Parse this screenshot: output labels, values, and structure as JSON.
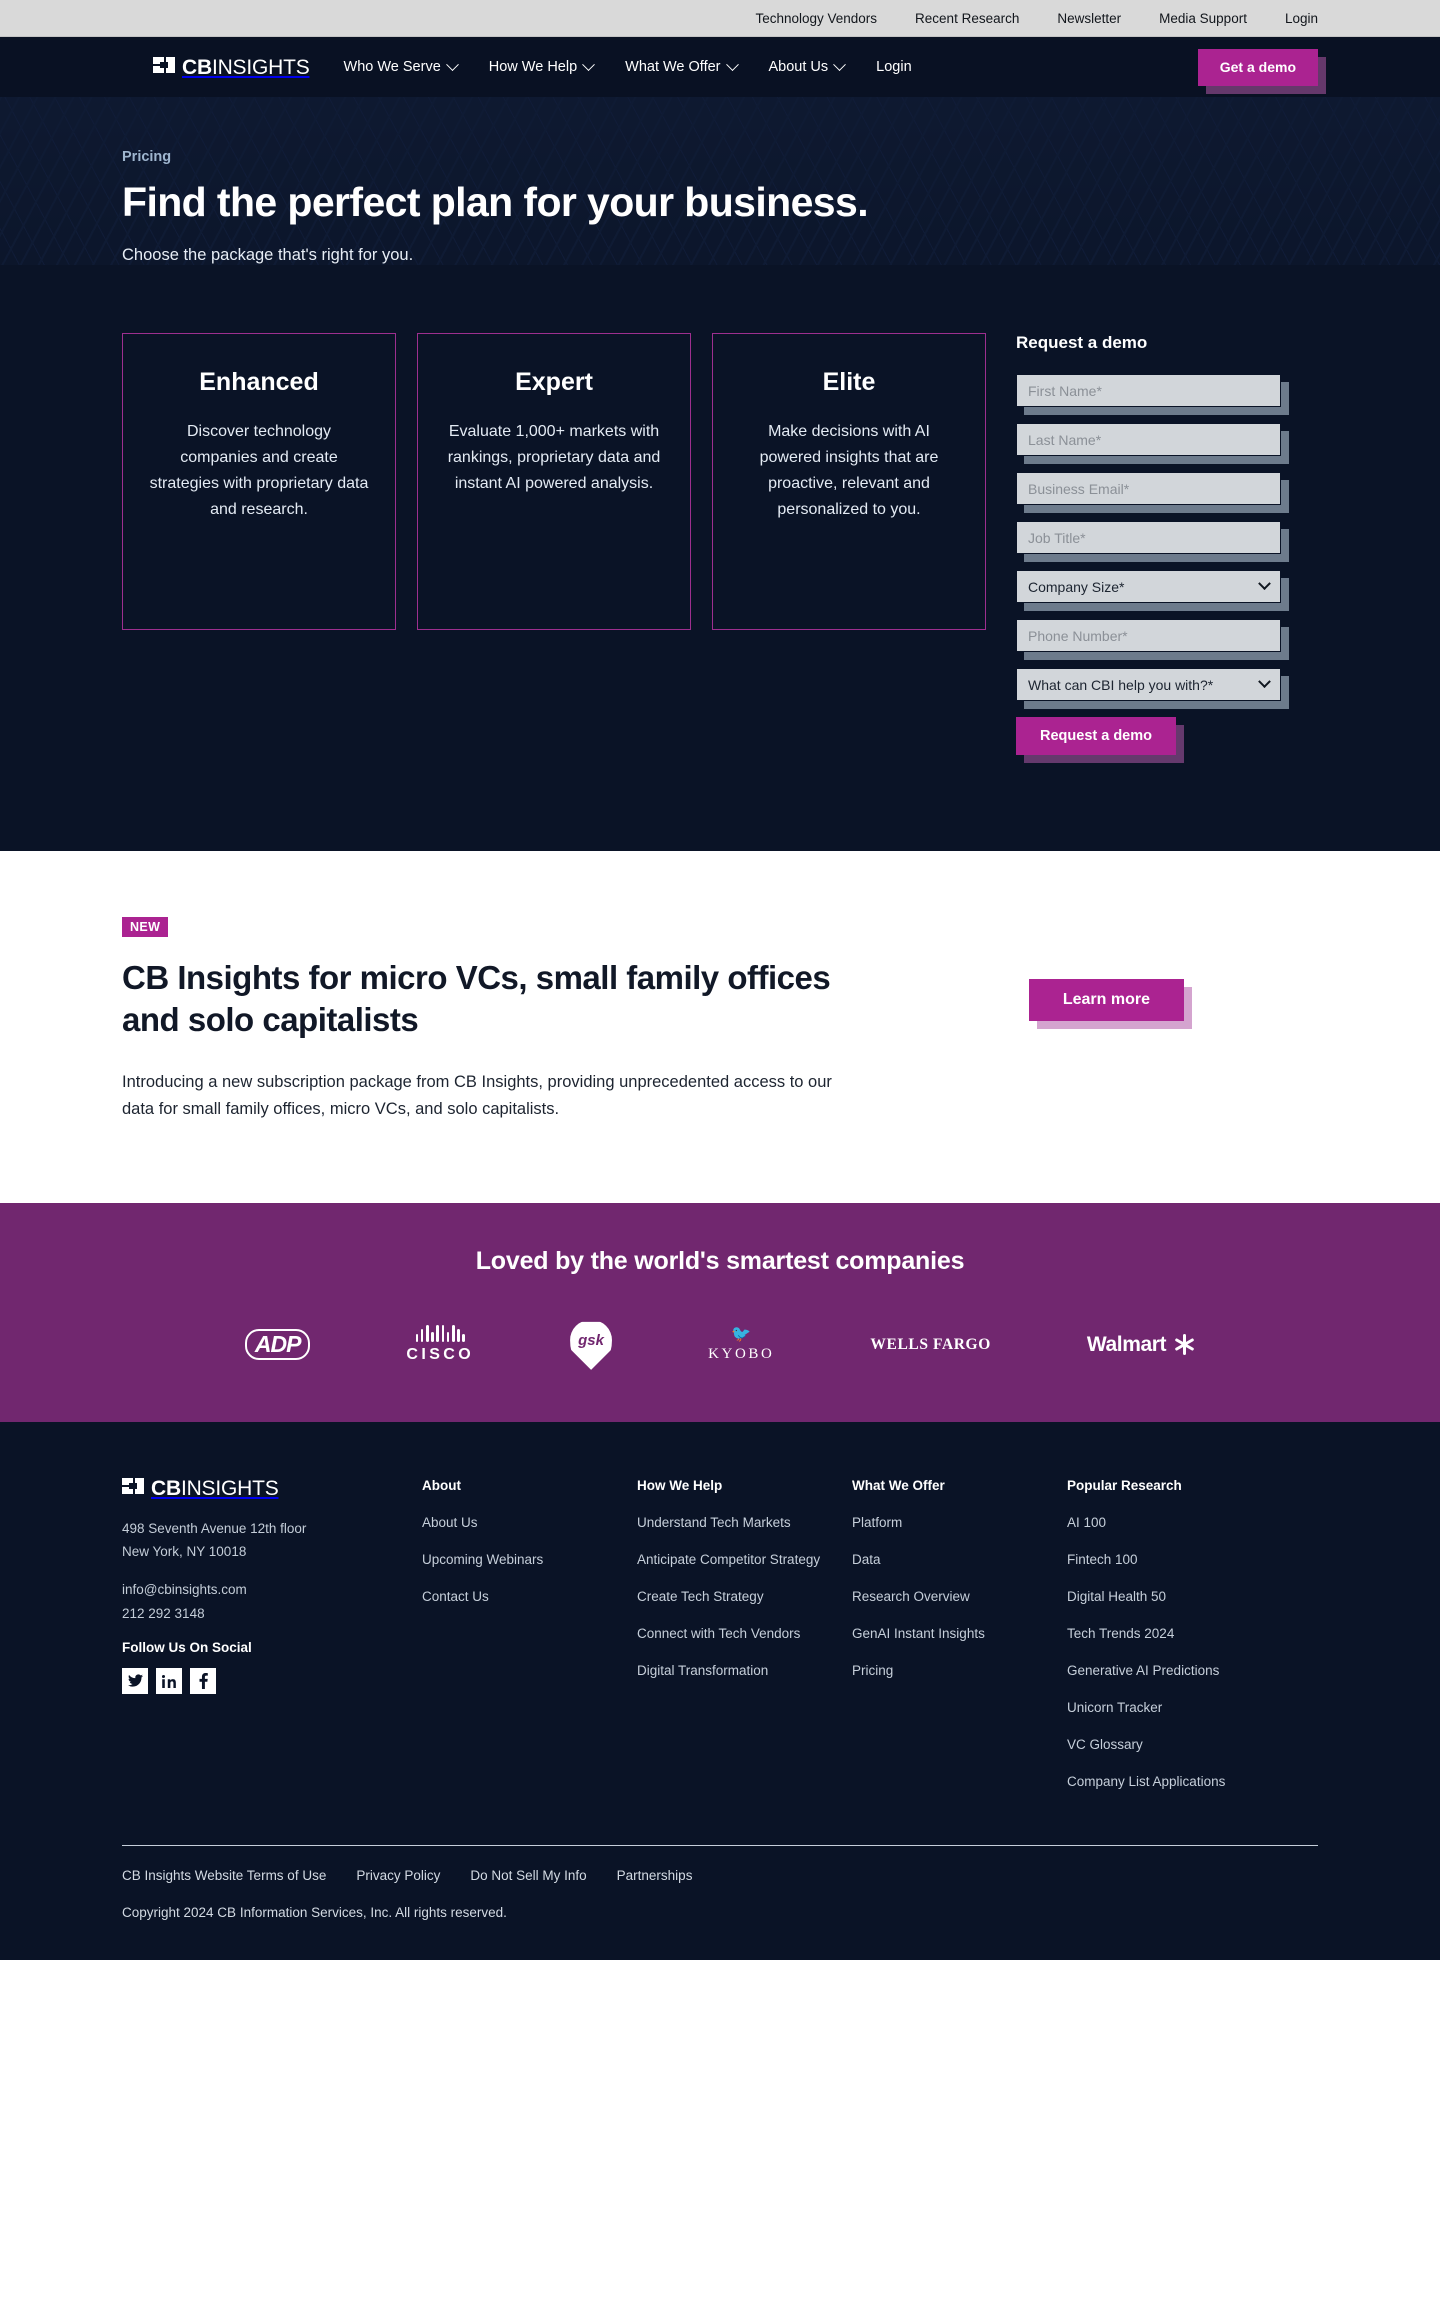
{
  "utility_bar": {
    "links": [
      "Technology Vendors",
      "Recent Research",
      "Newsletter",
      "Media Support",
      "Login"
    ]
  },
  "navbar": {
    "logo": {
      "bold": "CB",
      "light": "INSIGHTS"
    },
    "links": [
      {
        "label": "Who We Serve",
        "has_caret": true
      },
      {
        "label": "How We Help",
        "has_caret": true
      },
      {
        "label": "What We Offer",
        "has_caret": true
      },
      {
        "label": "About Us",
        "has_caret": true
      },
      {
        "label": "Login",
        "has_caret": false
      }
    ],
    "cta": "Get a demo"
  },
  "hero": {
    "eyebrow": "Pricing",
    "title": "Find the perfect plan for your business.",
    "subtitle": "Choose the package that's right for you."
  },
  "plans": [
    {
      "name": "Enhanced",
      "description": "Discover technology companies and create strategies with proprietary data and research."
    },
    {
      "name": "Expert",
      "description": "Evaluate 1,000+ markets with rankings, proprietary data and instant AI powered analysis."
    },
    {
      "name": "Elite",
      "description": "Make decisions with AI powered insights that are proactive, relevant and personalized to you."
    }
  ],
  "demo_form": {
    "title": "Request a demo",
    "first_name_placeholder": "First Name*",
    "last_name_placeholder": "Last Name*",
    "business_email_placeholder": "Business Email*",
    "job_title_placeholder": "Job Title*",
    "company_size_value": "Company Size*",
    "phone_placeholder": "Phone Number*",
    "help_with_value": "What can CBI help you with?*",
    "submit_label": "Request a demo"
  },
  "promo": {
    "badge": "NEW",
    "title": "CB Insights for micro VCs, small family offices and solo capitalists",
    "body": "Introducing a new subscription package from CB Insights, providing unprecedented access to our data for small family offices, micro VCs, and solo capitalists.",
    "cta": "Learn more"
  },
  "logos_band": {
    "title": "Loved by the world's smartest companies",
    "logos": [
      "ADP",
      "CISCO",
      "gsk",
      "KYOBO",
      "WELLS FARGO",
      "Walmart"
    ]
  },
  "footer": {
    "logo": {
      "bold": "CB",
      "light": "INSIGHTS"
    },
    "address_line1": "498 Seventh Avenue 12th floor",
    "address_line2": "New York, NY 10018",
    "email": "info@cbinsights.com",
    "phone": "212 292 3148",
    "social_label": "Follow Us On Social",
    "socials": [
      "twitter",
      "linkedin",
      "facebook"
    ],
    "columns": [
      {
        "heading": "About",
        "links": [
          "About Us",
          "Upcoming Webinars",
          "Contact Us"
        ]
      },
      {
        "heading": "How We Help",
        "links": [
          "Understand Tech Markets",
          "Anticipate Competitor Strategy",
          "Create Tech Strategy",
          "Connect with Tech Vendors",
          "Digital Transformation"
        ]
      },
      {
        "heading": "What We Offer",
        "links": [
          "Platform",
          "Data",
          "Research Overview",
          "GenAI Instant Insights",
          "Pricing"
        ]
      },
      {
        "heading": "Popular Research",
        "links": [
          "AI 100",
          "Fintech 100",
          "Digital Health 50",
          "Tech Trends 2024",
          "Generative AI Predictions",
          "Unicorn Tracker",
          "VC Glossary",
          "Company List Applications"
        ]
      }
    ],
    "legal_links": [
      "CB Insights Website Terms of Use",
      "Privacy Policy",
      "Do Not Sell My Info",
      "Partnerships"
    ],
    "copyright": "Copyright 2024 CB Information Services, Inc. All rights reserved."
  },
  "colors": {
    "brand_magenta": "#ab2391",
    "band_purple": "#71276f",
    "dark_navy": "#0a1326",
    "card_border": "#9d2f8f"
  }
}
